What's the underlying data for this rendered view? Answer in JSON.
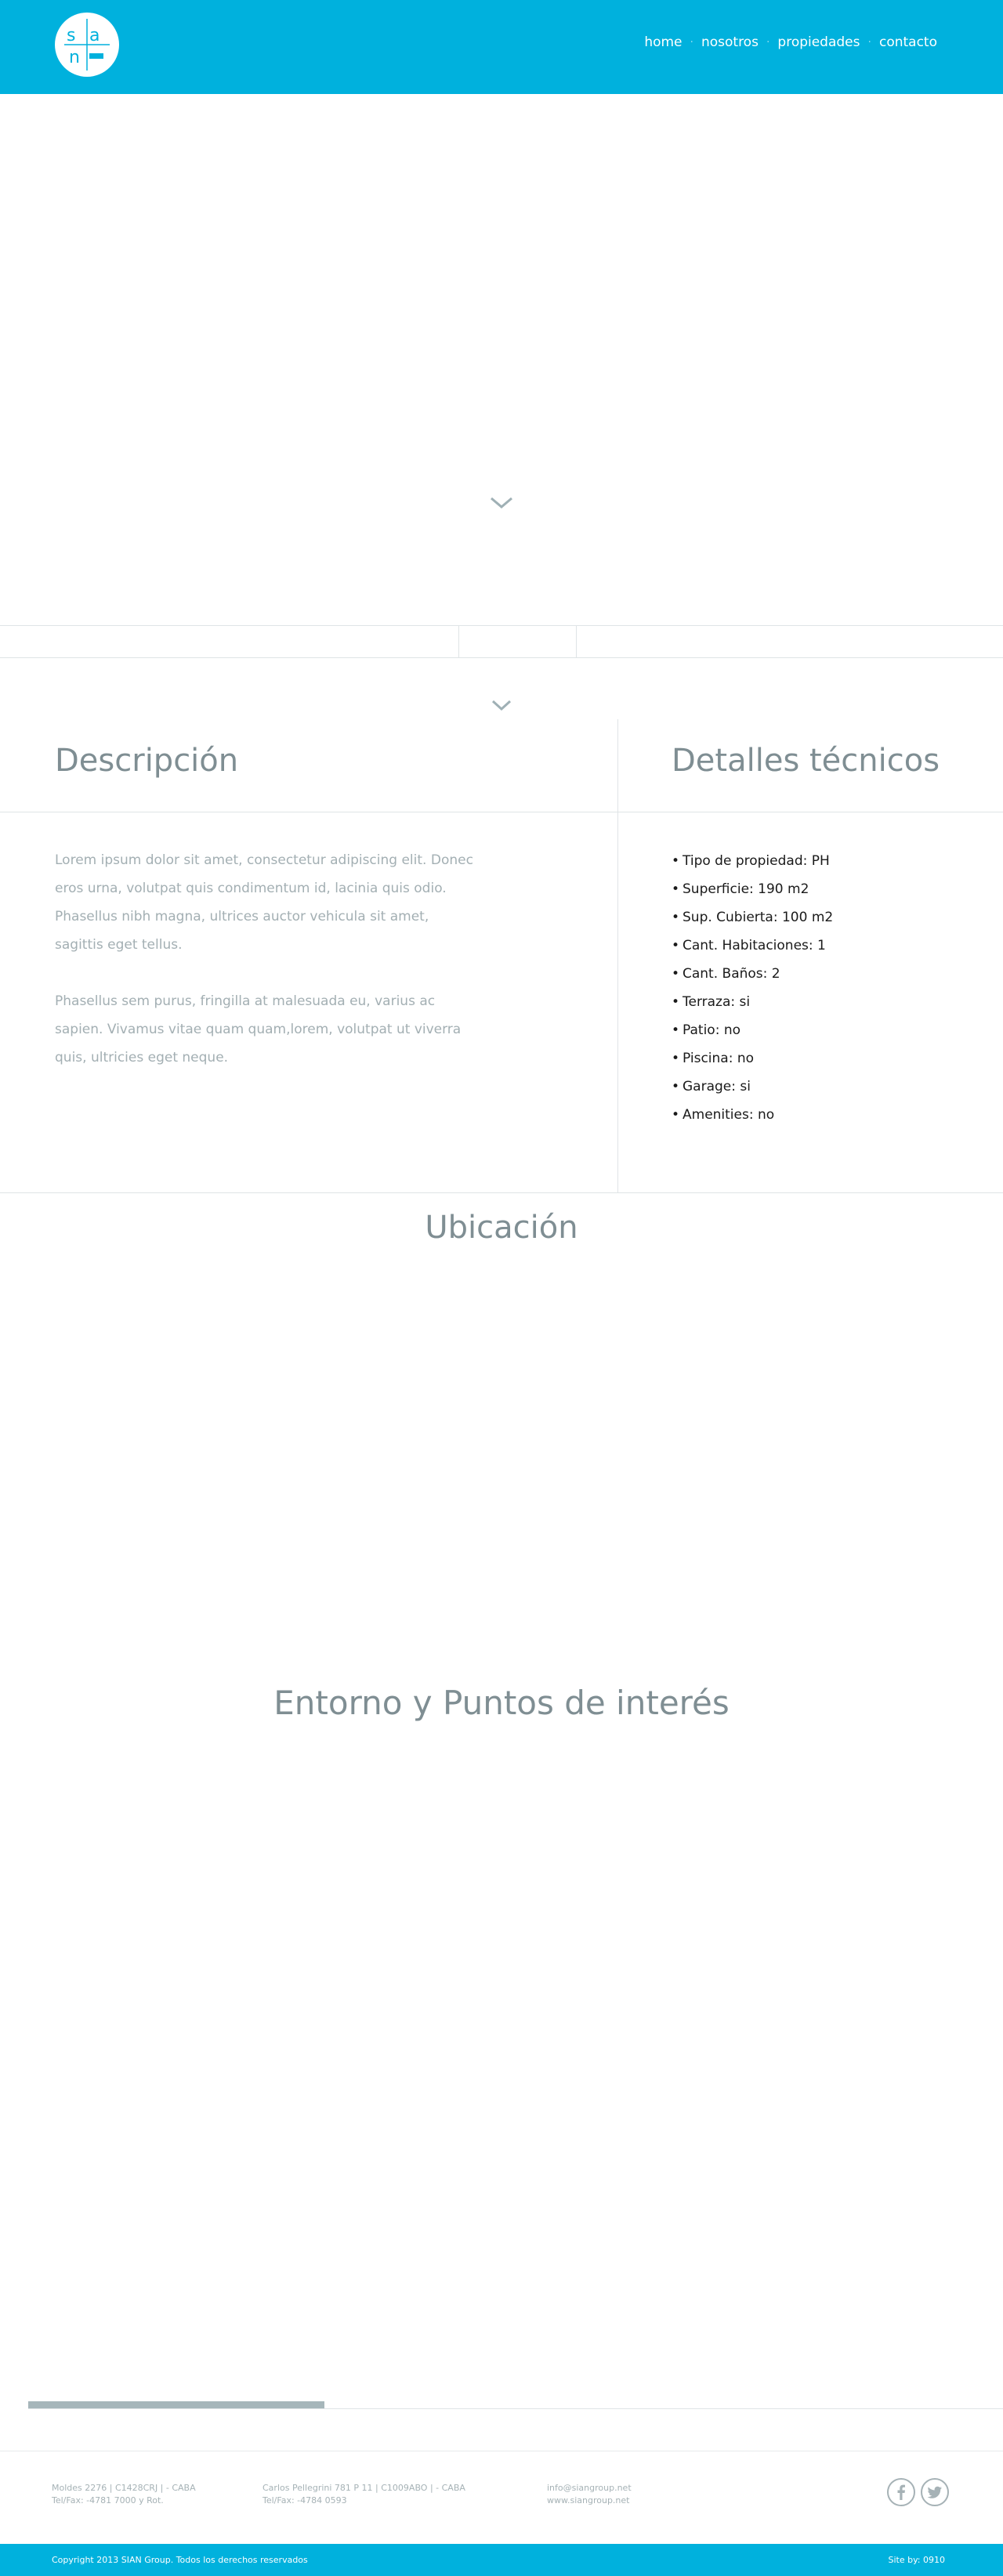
{
  "colors": {
    "brand": "#00b1dd",
    "heading": "#7f8e93",
    "body_text": "#a3afb3",
    "detail_text": "#1a1a1a",
    "divider": "#dfe4e6",
    "footer_text": "#a6b2b6"
  },
  "header": {
    "logo_icon": "sian-group-logo",
    "logo_text": "sian GROUP",
    "nav": [
      {
        "label": "home"
      },
      {
        "label": "nosotros"
      },
      {
        "label": "propiedades"
      },
      {
        "label": "contacto"
      }
    ]
  },
  "hero": {
    "scroll_icon": "chevron-down-icon"
  },
  "tabs": {
    "items": [
      "",
      "",
      ""
    ]
  },
  "descripcion": {
    "title": "Descripción",
    "paragraphs": [
      "Lorem ipsum dolor sit amet, consectetur adipiscing elit. Donec eros urna, volutpat quis condimentum id, lacinia quis odio. Phasellus nibh magna, ultrices auctor vehicula sit amet, sagittis eget tellus.",
      "Phasellus sem purus, fringilla at malesuada eu, varius ac sapien. Vivamus vitae quam quam,lorem, volutpat ut viverra quis, ultricies eget neque."
    ]
  },
  "detalles": {
    "title": "Detalles técnicos",
    "items": [
      "Tipo de propiedad: PH",
      "Superficie: 190 m2",
      "Sup. Cubierta: 100 m2",
      "Cant. Habitaciones: 1",
      "Cant. Baños: 2",
      "Terraza: si",
      "Patio: no",
      "Piscina: no",
      "Garage: si",
      "Amenities: no"
    ]
  },
  "ubicacion": {
    "title": "Ubicación"
  },
  "entorno": {
    "title": "Entorno y Puntos de interés"
  },
  "footer": {
    "col1": [
      "Moldes 2276 | C1428CRJ | - CABA",
      "Tel/Fax: -4781 7000 y Rot."
    ],
    "col2": [
      "Carlos Pellegrini 781 P 11 | C1009ABO | - CABA",
      "Tel/Fax: -4784 0593"
    ],
    "col3": [
      "info@siangroup.net",
      "www.siangroup.net"
    ],
    "social": [
      "facebook-icon",
      "twitter-icon"
    ],
    "copyright": "Copyright 2013 SIAN Group. Todos los derechos reservados",
    "credit": "Site by: 0910"
  }
}
